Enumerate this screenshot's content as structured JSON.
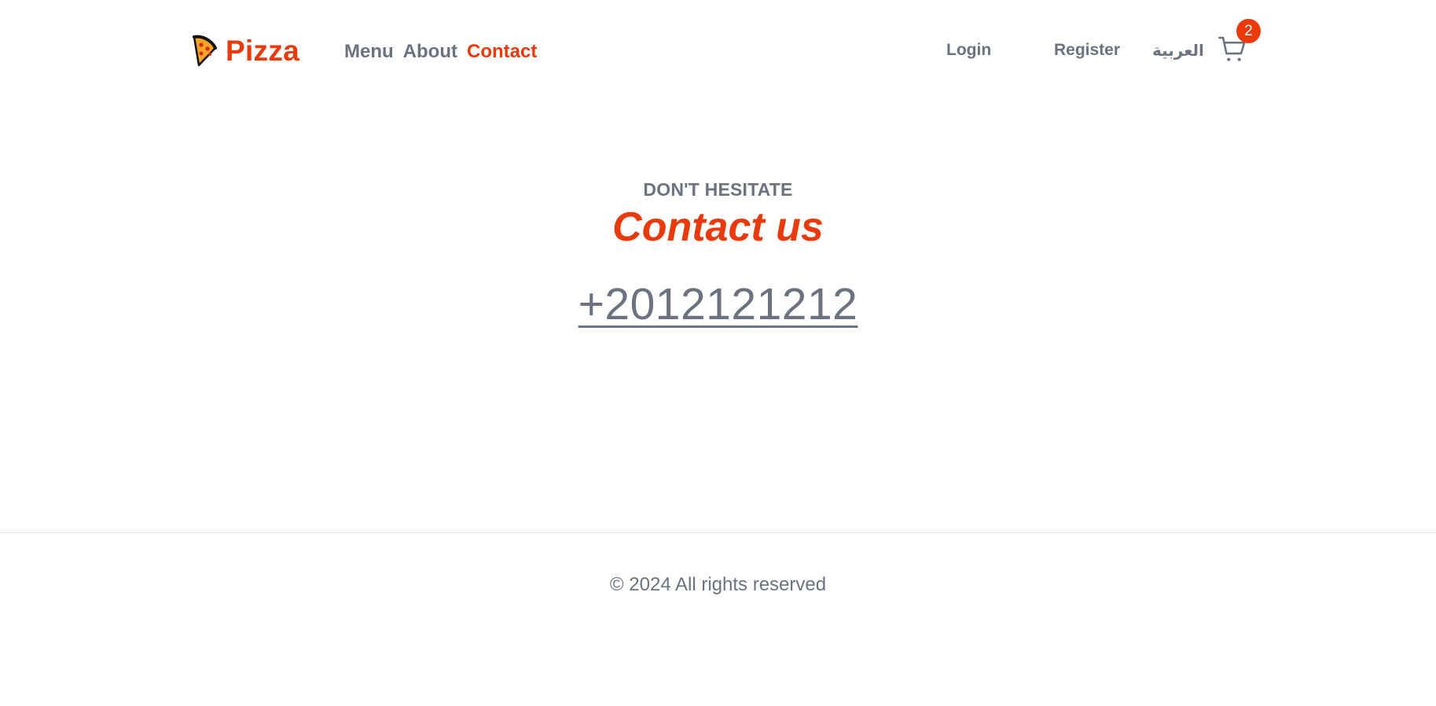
{
  "brand": {
    "name": "Pizza",
    "icon": "pizza-slice-icon"
  },
  "nav": {
    "items": [
      {
        "label": "Menu",
        "active": false
      },
      {
        "label": "About",
        "active": false
      },
      {
        "label": "Contact",
        "active": true
      }
    ]
  },
  "auth": {
    "login_label": "Login",
    "register_label": "Register"
  },
  "language": {
    "label": "العربية"
  },
  "cart": {
    "icon": "shopping-cart-icon",
    "count": "2"
  },
  "hero": {
    "eyebrow": "DON'T HESITATE",
    "title": "Contact us",
    "phone": "+2012121212"
  },
  "footer": {
    "copyright": "© 2024 All rights reserved"
  },
  "colors": {
    "accent": "#ea3a0c",
    "text_muted": "#6b7280",
    "divider": "#e5e7eb",
    "background": "#ffffff"
  }
}
